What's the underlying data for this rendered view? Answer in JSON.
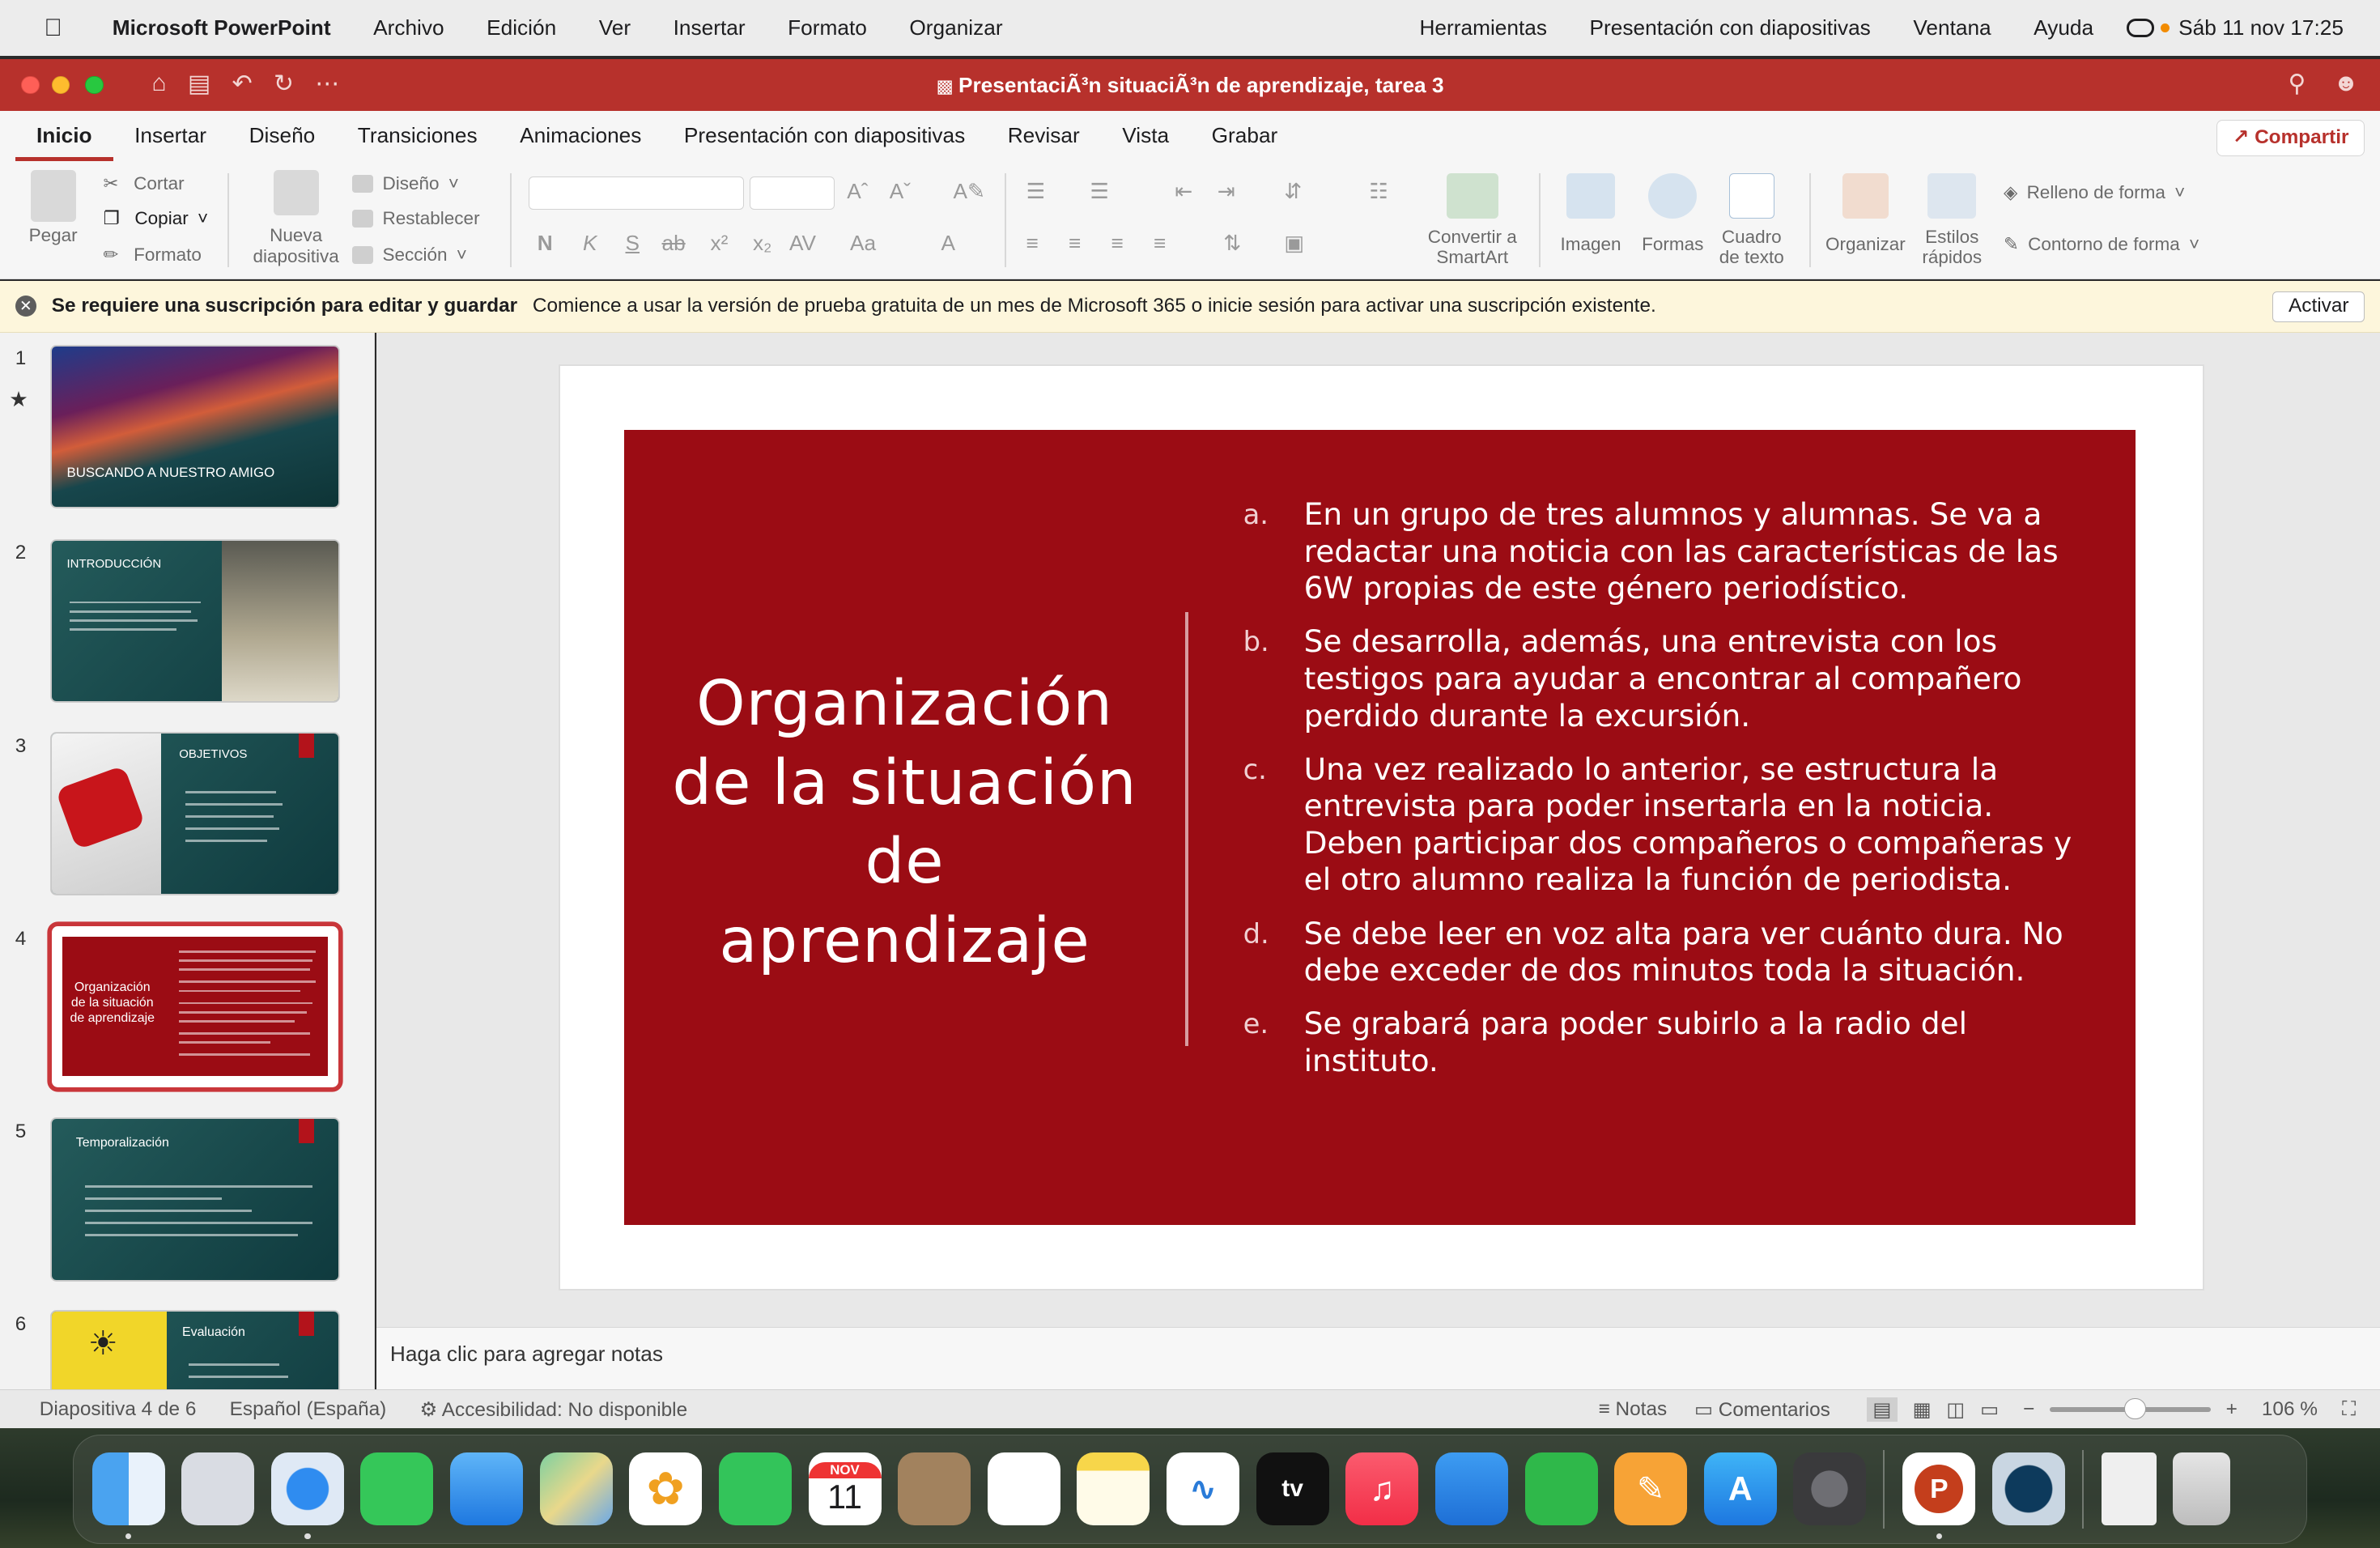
{
  "menubar": {
    "app": "Microsoft PowerPoint",
    "items": [
      "Archivo",
      "Edición",
      "Ver",
      "Insertar",
      "Formato",
      "Organizar"
    ],
    "right_items": [
      "Herramientas",
      "Presentación con diapositivas",
      "Ventana",
      "Ayuda"
    ],
    "datetime": "Sáb 11 nov 17:25"
  },
  "window": {
    "title": "PresentaciÃ³n situaciÃ³n de aprendizaje, tarea 3"
  },
  "ribbon_tabs": [
    "Inicio",
    "Insertar",
    "Diseño",
    "Transiciones",
    "Animaciones",
    "Presentación con diapositivas",
    "Revisar",
    "Vista",
    "Grabar"
  ],
  "share_label": "Compartir",
  "ribbon": {
    "paste": "Pegar",
    "cut": "Cortar",
    "copy": "Copiar",
    "format": "Formato",
    "new_slide": "Nueva diapositiva",
    "layout": "Diseño",
    "reset": "Restablecer",
    "section": "Sección",
    "convert_smartart": "Convertir a SmartArt",
    "image": "Imagen",
    "shapes": "Formas",
    "textbox": "Cuadro de texto",
    "arrange": "Organizar",
    "quick_styles": "Estilos rápidos",
    "shape_fill": "Relleno de forma",
    "shape_outline": "Contorno de forma",
    "bold": "N",
    "italic": "K",
    "underline": "S",
    "strike": "ab",
    "superscript": "x²",
    "subscript": "x₂",
    "spacing": "AV",
    "case": "Aa",
    "font_color": "A"
  },
  "notification": {
    "bold": "Se requiere una suscripción para editar y guardar",
    "message": "Comience a usar la versión de prueba gratuita de un mes de Microsoft 365 o inicie sesión para activar una suscripción existente.",
    "button": "Activar"
  },
  "thumbnails": [
    {
      "num": "1",
      "label": "BUSCANDO A NUESTRO AMIGO"
    },
    {
      "num": "2",
      "label": "INTRODUCCIÓN"
    },
    {
      "num": "3",
      "label": "OBJETIVOS"
    },
    {
      "num": "4",
      "label": "Organización de la situación de aprendizaje"
    },
    {
      "num": "5",
      "label": "Temporalización"
    },
    {
      "num": "6",
      "label": "Evaluación"
    }
  ],
  "slide": {
    "title": "Organización de la situación de aprendizaje",
    "items": [
      {
        "letter": "a.",
        "text": "En un grupo de tres alumnos y alumnas. Se va a redactar una noticia con las características de las 6W propias de este género periodístico."
      },
      {
        "letter": "b.",
        "text": "Se desarrolla, además, una entrevista con los testigos para ayudar a encontrar al compañero perdido durante la excursión."
      },
      {
        "letter": "c.",
        "text": "Una vez realizado lo anterior, se estructura la entrevista para poder insertarla en la noticia.  Deben participar dos compañeros o compañeras y el otro alumno realiza la función de periodista."
      },
      {
        "letter": "d.",
        "text": "Se debe leer en voz alta para ver cuánto dura. No debe exceder de dos minutos toda la situación."
      },
      {
        "letter": "e.",
        "text": "Se grabará para poder subirlo a la radio del instituto."
      }
    ]
  },
  "notes_placeholder": "Haga clic para agregar notas",
  "status": {
    "slide_info": "Diapositiva 4 de 6",
    "language": "Español (España)",
    "accessibility": "Accesibilidad: No disponible",
    "notes": "Notas",
    "comments": "Comentarios",
    "zoom": "106 %",
    "zoom_level": 0.53
  },
  "dock": {
    "calendar_month": "NOV",
    "calendar_day": "11",
    "tv_label": "tv"
  },
  "colors": {
    "accent": "#b7312c",
    "slide_panel": "#9b0c14",
    "selected_thumb": "#c9363a"
  }
}
